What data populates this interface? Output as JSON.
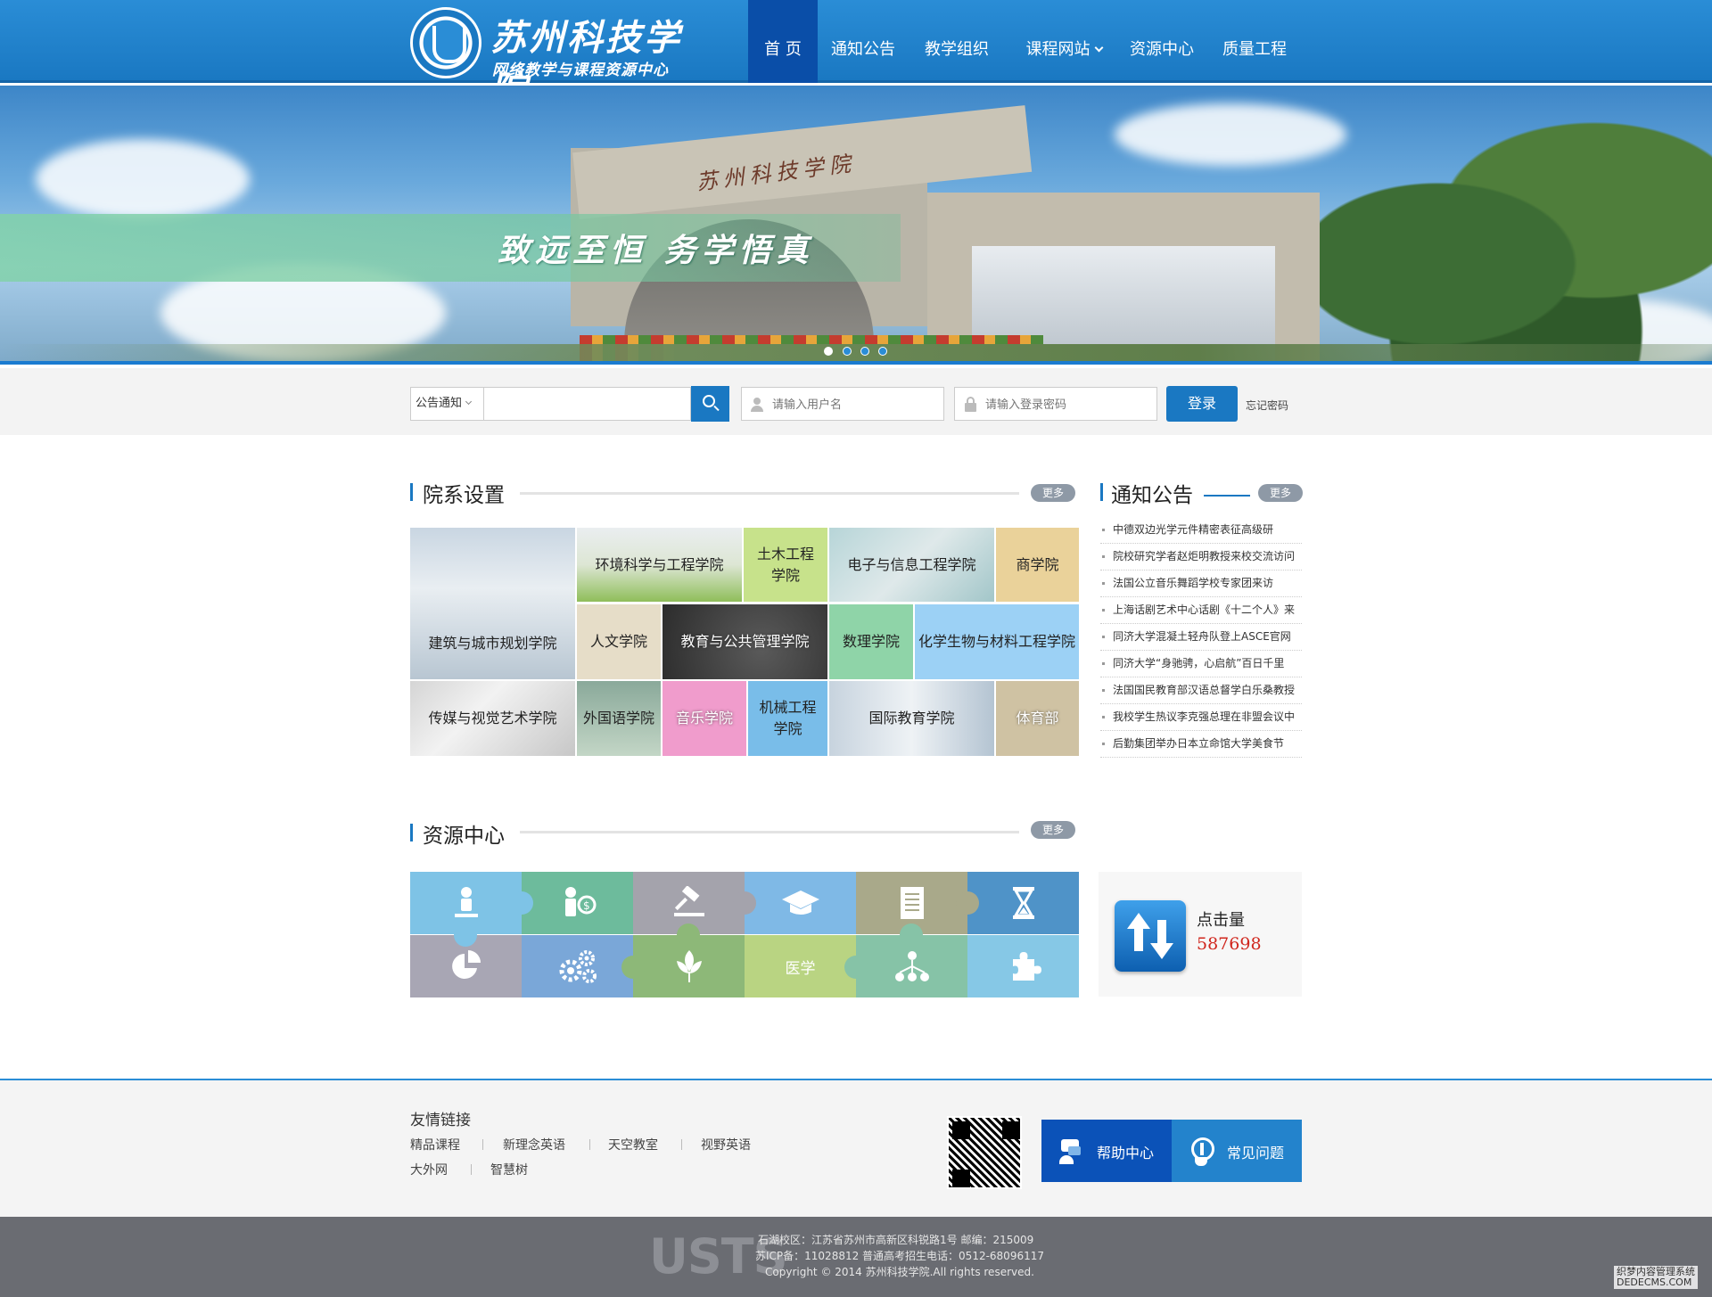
{
  "header": {
    "logo_name": "苏州科技学院",
    "logo_sub": "网络教学与课程资源中心",
    "nav": [
      {
        "label": "首 页"
      },
      {
        "label": "通知公告"
      },
      {
        "label": "教学组织"
      },
      {
        "label": "课程网站"
      },
      {
        "label": "资源中心"
      },
      {
        "label": "质量工程"
      }
    ],
    "active_nav": "首 页",
    "accent_color": "#1a78c2"
  },
  "banner": {
    "slogan": "致远至恒  务学悟真",
    "gate_text": "苏州科技学院",
    "slide_count": 4,
    "active_slide": 1
  },
  "search": {
    "category": "公告通知",
    "keyword_value": "",
    "username_placeholder": "请输入用户名",
    "password_placeholder": "请输入登录密码",
    "login_label": "登录",
    "forgot_label": "忘记密码"
  },
  "departments": {
    "title": "院系设置",
    "more": "更多",
    "tiles": [
      "建筑与城市规划学院",
      "环境科学与工程学院",
      "土木工程学院",
      "电子与信息工程学院",
      "商学院",
      "人文学院",
      "教育与公共管理学院",
      "数理学院",
      "化学生物与材料工程学院",
      "传媒与视觉艺术学院",
      "外国语学院",
      "音乐学院",
      "机械工程学院",
      "国际教育学院",
      "体育部"
    ],
    "tiles_lines": {
      "civil": [
        "土木工程",
        "学院"
      ],
      "mech": [
        "机械工程",
        "学院"
      ]
    }
  },
  "notices": {
    "title": "通知公告",
    "more": "更多",
    "items": [
      "中德双边光学元件精密表征高级研",
      "院校研究学者赵炬明教授来校交流访问",
      "法国公立音乐舞蹈学校专家团来访",
      "上海话剧艺术中心话剧《十二个人》来",
      "同济大学混凝土轻舟队登上ASCE官网",
      "同济大学“身驰骋，心启航”百日千里",
      "法国国民教育部汉语总督学白乐桑教授",
      "我校学生热议李克强总理在非盟会议中",
      "后勤集团举办日本立命馆大学美食节"
    ]
  },
  "resources": {
    "title": "资源中心",
    "more": "更多",
    "tiles": [
      {
        "icon": "person-icon",
        "color": "#7ec3e6"
      },
      {
        "icon": "money-person-icon",
        "color": "#6dbb9c"
      },
      {
        "icon": "gavel-icon",
        "color": "#a4a3ac"
      },
      {
        "icon": "graduation-cap-icon",
        "color": "#7fb9e6"
      },
      {
        "icon": "document-icon",
        "color": "#a9a98a"
      },
      {
        "icon": "hourglass-icon",
        "color": "#4f93c8"
      },
      {
        "icon": "pie-chart-icon",
        "color": "#a8a6b4"
      },
      {
        "icon": "gears-icon",
        "color": "#7aa7d8"
      },
      {
        "icon": "leaf-icon",
        "color": "#8db878"
      },
      {
        "label": "医学",
        "color": "#b9d482"
      },
      {
        "icon": "network-icon",
        "color": "#86c3a7"
      },
      {
        "icon": "puzzle-icon",
        "color": "#86c8e6"
      }
    ]
  },
  "counter": {
    "label": "点击量",
    "value": "587698",
    "value_color": "#d0261d"
  },
  "footer": {
    "links_title": "友情链接",
    "links_row1": [
      "精品课程",
      "新理念英语",
      "天空教室",
      "视野英语"
    ],
    "links_row2": [
      "大外网",
      "智慧树"
    ],
    "help_label": "帮助中心",
    "faq_label": "常见问题",
    "brand": "USTS",
    "address": "石湖校区：江苏省苏州市高新区科锐路1号 邮编：215009",
    "icp": "苏ICP备：11028812 普通高考招生电话：0512-68096117",
    "copyright": "Copyright © 2014 苏州科技学院.All rights reserved.",
    "watermark": "织梦内容管理系统\nDEDECMS.COM"
  }
}
